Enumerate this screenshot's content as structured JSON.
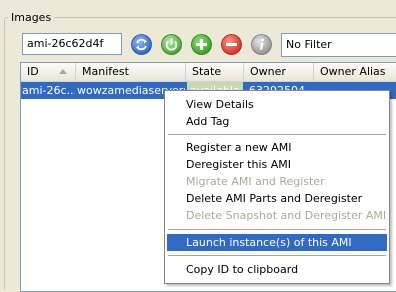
{
  "group": {
    "title": "Images"
  },
  "toolbar": {
    "search_value": "ami-26c62d4f",
    "filter_value": "No Filter",
    "icons": [
      "refresh-icon",
      "power-icon",
      "add-icon",
      "remove-icon",
      "info-icon"
    ]
  },
  "table": {
    "columns": [
      "ID",
      "Manifest",
      "State",
      "Owner",
      "Owner Alias"
    ],
    "sorted_column": "ID",
    "rows": [
      {
        "id": "ami-26c...",
        "manifest": "wowzamediaserveru...",
        "state": "available",
        "owner": "63292504",
        "owner_alias": ""
      }
    ]
  },
  "context_menu": {
    "items": [
      {
        "label": "View Details",
        "enabled": true
      },
      {
        "label": "Add Tag",
        "enabled": true
      },
      {
        "label": "Register a new AMI",
        "enabled": true
      },
      {
        "label": "Deregister this AMI",
        "enabled": true
      },
      {
        "label": "Migrate AMI and Register",
        "enabled": false
      },
      {
        "label": "Delete AMI Parts and Deregister",
        "enabled": true
      },
      {
        "label": "Delete Snapshot and Deregister AMI",
        "enabled": false
      },
      {
        "label": "Launch instance(s) of this AMI",
        "enabled": true,
        "highlighted": true
      },
      {
        "label": "Copy ID to clipboard",
        "enabled": true
      }
    ]
  },
  "colors": {
    "selection": "#316ac5",
    "window_bg": "#ece9d8",
    "disabled_text": "#aca899"
  }
}
